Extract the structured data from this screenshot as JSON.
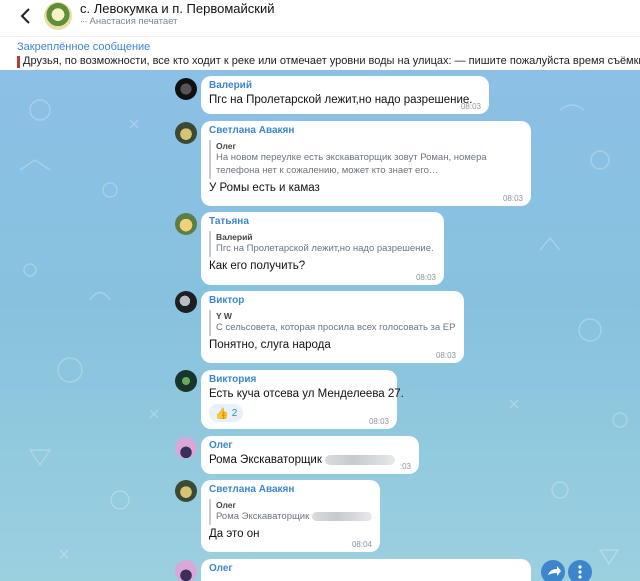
{
  "header": {
    "back_icon": "chevron-left-icon",
    "chat_title": "с. Левокумка и п. Первомайский",
    "typing_status": "Анастасия печатает"
  },
  "pinned": {
    "title": "Закреплённое сообщение",
    "text": "Друзья, по возможности, все кто ходит к реке или отмечает уровни воды на улицах: — пишите пожалуйста время съёмки; — м"
  },
  "messages": [
    {
      "sender": "Валерий",
      "sender_color": "#3d86cc",
      "text": "Пгс на Пролетарской лежит,но надо разрешение.",
      "time": "08:03"
    },
    {
      "sender": "Светлана Авакян",
      "sender_color": "#3d86cc",
      "reply": {
        "name": "Олег",
        "text": "На новом переулке есть экскаваторщик зовут Роман, номера телефона нет к сожалению, может кто знает его…"
      },
      "text": "У Ромы есть и камаз",
      "time": "08:03"
    },
    {
      "sender": "Татьяна",
      "sender_color": "#3d86cc",
      "reply": {
        "name": "Валерий",
        "text": "Пгс на Пролетарской лежит,но надо разрешение."
      },
      "text": "Как его получить?",
      "time": "08:03"
    },
    {
      "sender": "Виктор",
      "sender_color": "#3d86cc",
      "reply": {
        "name": "Y W",
        "text": "С сельсовета, которая просила всех голосовать за ЕР"
      },
      "text": "Понятно, слуга народа",
      "time": "08:03"
    },
    {
      "sender": "Виктория",
      "sender_color": "#3d86cc",
      "text": "Есть куча отсева ул Менделеева 27.",
      "reaction_count": "2",
      "time": "08:03"
    },
    {
      "sender": "Олег",
      "sender_color": "#3d86cc",
      "text": "Рома Экскаваторщик",
      "time": ":03"
    },
    {
      "sender": "Светлана Авакян",
      "sender_color": "#3d86cc",
      "reply": {
        "name": "Олег",
        "text": "Рома Экскаваторщик"
      },
      "text": "Да это он",
      "time": "08:04"
    },
    {
      "sender": "Олег",
      "sender_color": "#3d86cc",
      "text": ""
    }
  ],
  "fab": {
    "share_icon": "share-icon",
    "menu_icon": "more-vertical-icon"
  }
}
